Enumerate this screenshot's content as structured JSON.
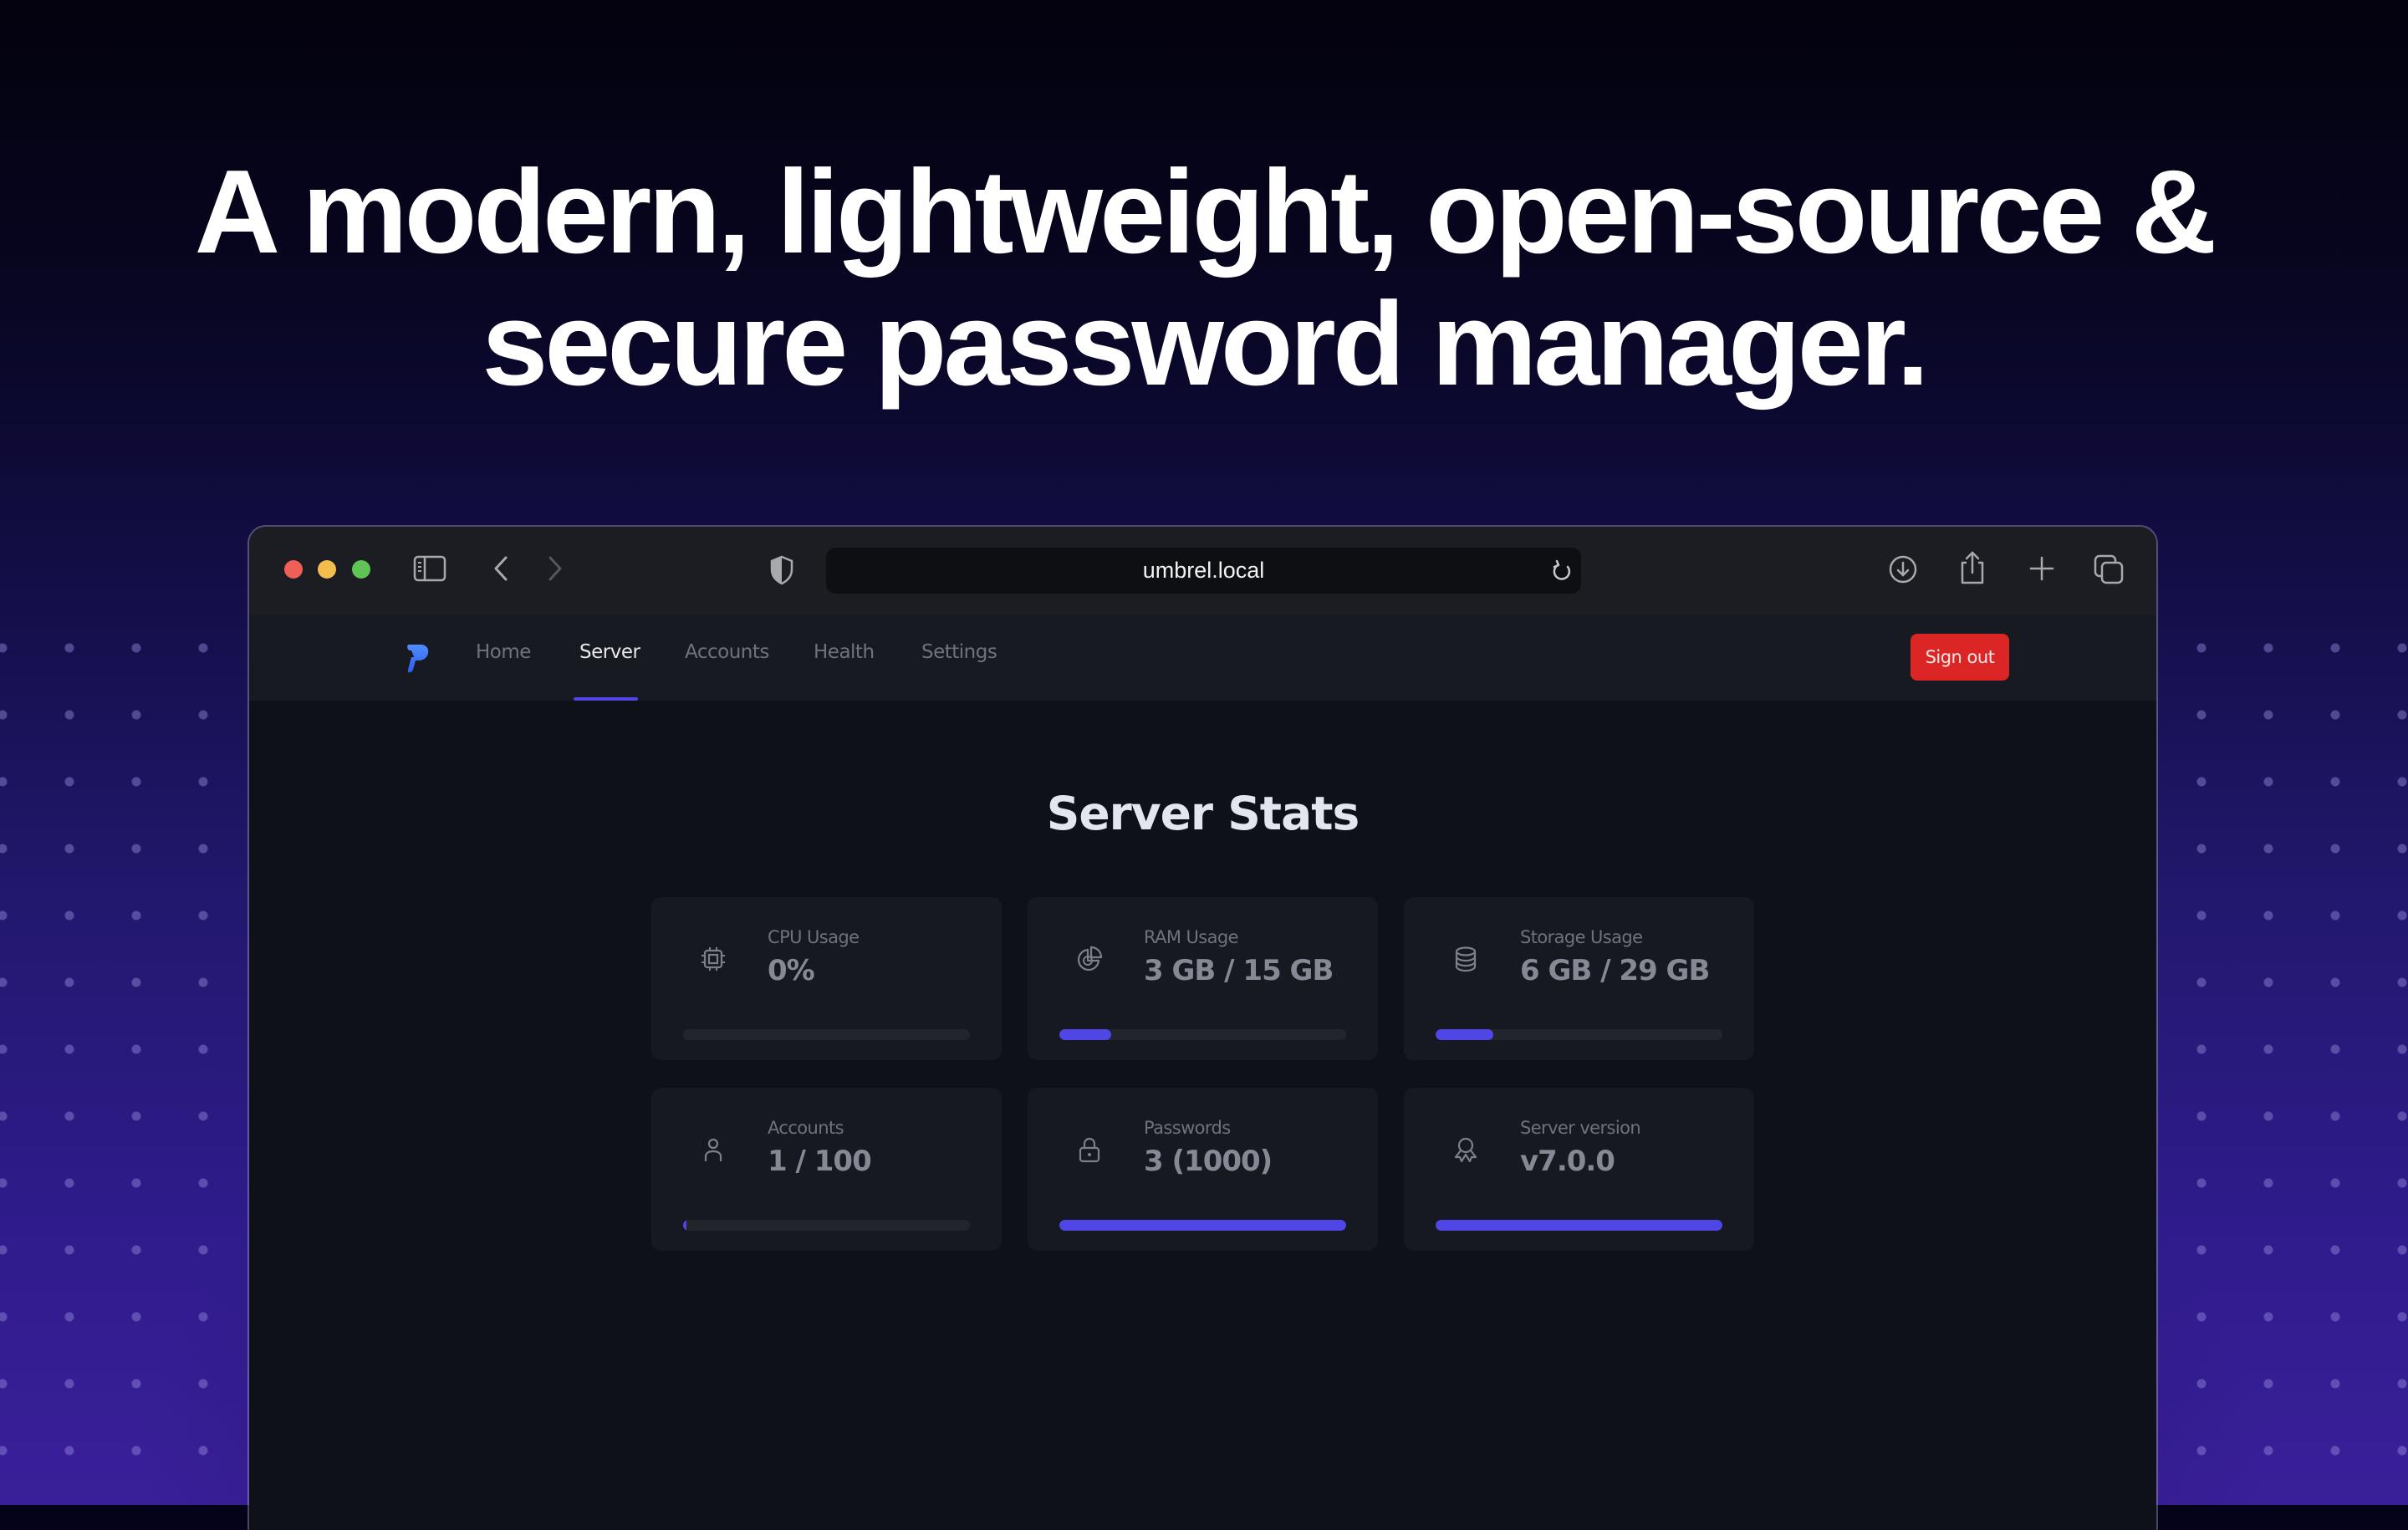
{
  "headline": {
    "line1": "A modern, lightweight, open-source &",
    "line2": "secure password manager."
  },
  "browser": {
    "url": "umbrel.local",
    "icons": [
      "sidebar-icon",
      "back-chevron-icon",
      "forward-chevron-icon",
      "privacy-shield-icon",
      "reload-icon",
      "download-icon",
      "share-icon",
      "new-tab-plus-icon",
      "tabs-overview-icon"
    ]
  },
  "app": {
    "logo": "P",
    "nav": [
      {
        "label": "Home",
        "active": false
      },
      {
        "label": "Server",
        "active": true
      },
      {
        "label": "Accounts",
        "active": false
      },
      {
        "label": "Health",
        "active": false
      },
      {
        "label": "Settings",
        "active": false
      }
    ],
    "sign_out": "Sign out",
    "page_title": "Server Stats",
    "accent_color": "#5046e5",
    "danger_color": "#dc2626",
    "stats": [
      {
        "label": "CPU Usage",
        "value": "0%",
        "icon": "cpu-chip-icon",
        "progress": 0.0
      },
      {
        "label": "RAM Usage",
        "value": "3 GB / 15 GB",
        "icon": "chart-pie-icon",
        "progress": 0.18
      },
      {
        "label": "Storage Usage",
        "value": "6 GB / 29 GB",
        "icon": "database-icon",
        "progress": 0.2
      },
      {
        "label": "Accounts",
        "value": "1 / 100",
        "icon": "user-icon",
        "progress": 0.01
      },
      {
        "label": "Passwords",
        "value": "3 (1000)",
        "icon": "lock-icon",
        "progress": 1.0
      },
      {
        "label": "Server version",
        "value": "v7.0.0",
        "icon": "badge-award-icon",
        "progress": 1.0
      }
    ]
  }
}
